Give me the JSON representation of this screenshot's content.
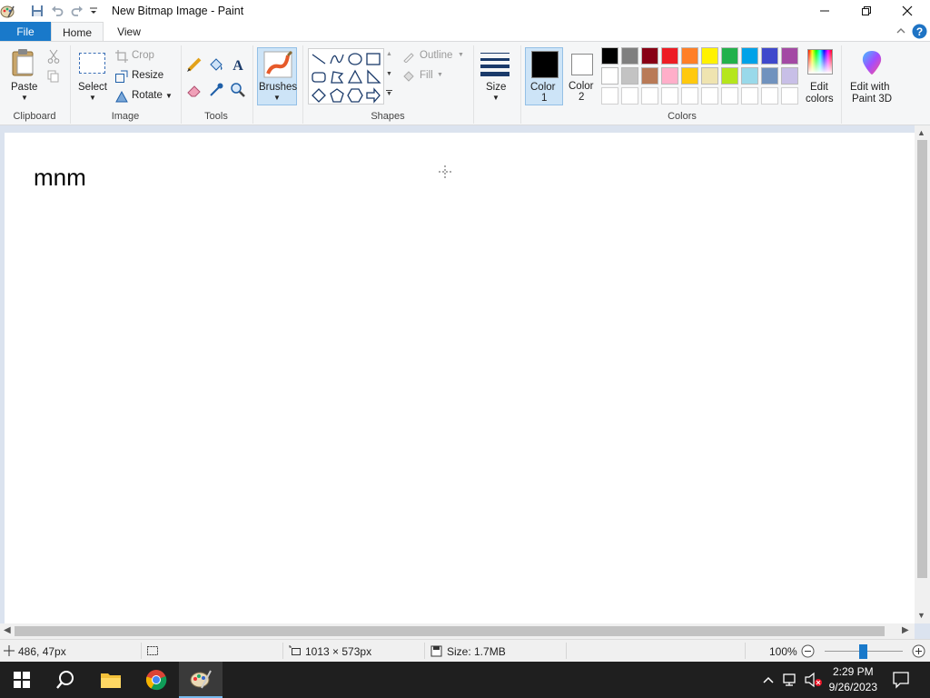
{
  "window": {
    "title": "New Bitmap Image - Paint"
  },
  "tabs": {
    "file": "File",
    "home": "Home",
    "view": "View"
  },
  "ribbon": {
    "clipboard": {
      "paste": "Paste",
      "group": "Clipboard"
    },
    "image": {
      "select": "Select",
      "crop": "Crop",
      "resize": "Resize",
      "rotate": "Rotate",
      "group": "Image"
    },
    "tools": {
      "group": "Tools"
    },
    "brushes": {
      "label": "Brushes"
    },
    "shapes": {
      "outline": "Outline",
      "fill": "Fill",
      "group": "Shapes"
    },
    "size": {
      "label": "Size"
    },
    "colors": {
      "color1": "Color",
      "color1_num": "1",
      "color2": "Color",
      "color2_num": "2",
      "edit_colors_1": "Edit",
      "edit_colors_2": "colors",
      "paint3d_1": "Edit with",
      "paint3d_2": "Paint 3D",
      "group": "Colors",
      "color1_value": "#000000",
      "color2_value": "#ffffff",
      "palette_row1": [
        "#000000",
        "#7f7f7f",
        "#880015",
        "#ed1c24",
        "#ff7f27",
        "#fff200",
        "#22b14c",
        "#00a2e8",
        "#3f48cc",
        "#a349a4"
      ],
      "palette_row2": [
        "#ffffff",
        "#c3c3c3",
        "#b97a57",
        "#ffaec9",
        "#ffc90e",
        "#efe4b0",
        "#b5e61d",
        "#99d9ea",
        "#7092be",
        "#c8bfe7"
      ]
    }
  },
  "canvas": {
    "text": "mnm"
  },
  "status": {
    "cursor_pos": "486, 47px",
    "canvas_size": "1013 × 573px",
    "file_size": "Size: 1.7MB",
    "zoom": "100%"
  },
  "taskbar": {
    "time": "2:29 PM",
    "date": "9/26/2023"
  }
}
